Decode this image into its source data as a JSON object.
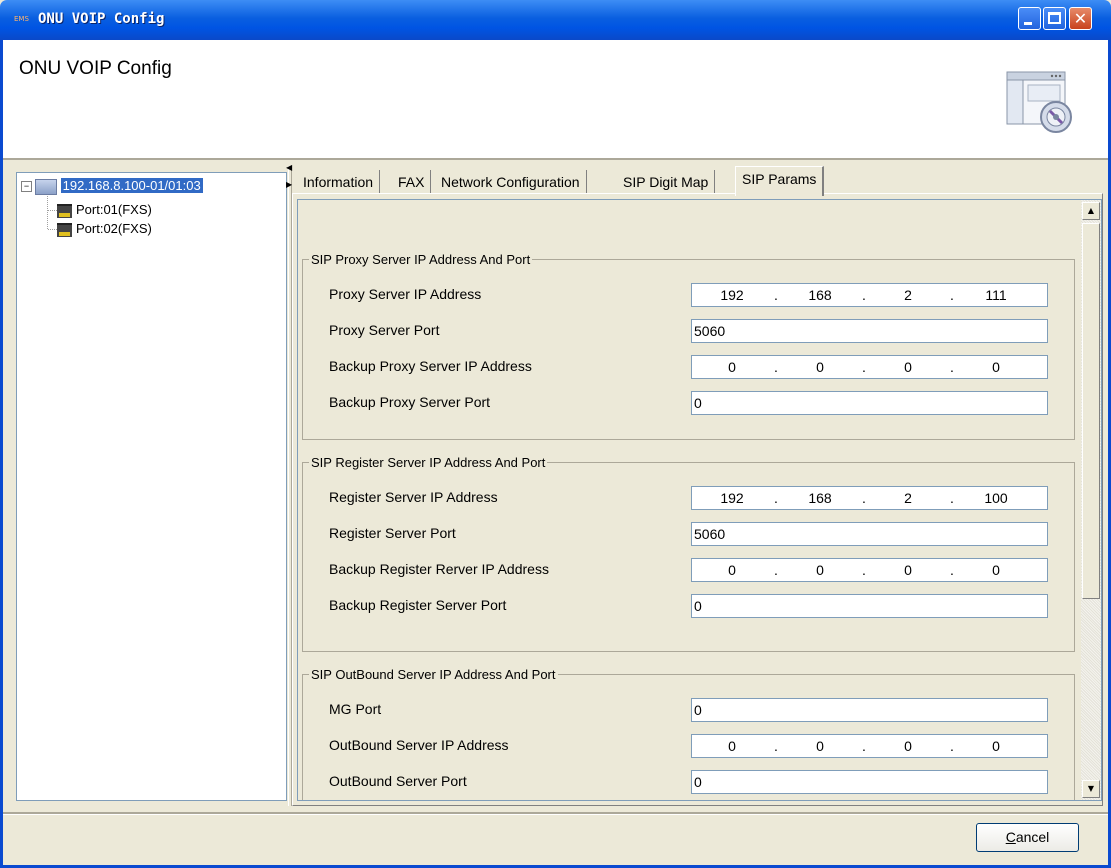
{
  "window": {
    "app_badge": "EMS",
    "title": "ONU VOIP Config"
  },
  "header": {
    "title": "ONU VOIP Config"
  },
  "tree": {
    "root": "192.168.8.100-01/01:03",
    "children": [
      "Port:01(FXS)",
      "Port:02(FXS)"
    ]
  },
  "tabs": [
    "Information",
    "FAX",
    "Network Configuration",
    "SIP Digit Map",
    "SIP Params"
  ],
  "active_tab": "SIP Params",
  "groups": [
    {
      "legend": "SIP Proxy Server IP Address And Port",
      "rows": [
        {
          "label": "Proxy Server IP Address",
          "ip": [
            "192",
            "168",
            "2",
            "111"
          ]
        },
        {
          "label": "Proxy Server Port",
          "value": "5060"
        },
        {
          "label": "Backup Proxy Server IP Address",
          "ip": [
            "0",
            "0",
            "0",
            "0"
          ]
        },
        {
          "label": "Backup Proxy Server Port",
          "value": "0"
        }
      ]
    },
    {
      "legend": "SIP Register Server IP Address And Port",
      "rows": [
        {
          "label": "Register Server IP Address",
          "ip": [
            "192",
            "168",
            "2",
            "100"
          ]
        },
        {
          "label": "Register Server Port",
          "value": "5060"
        },
        {
          "label": "Backup Register Rerver IP Address",
          "ip": [
            "0",
            "0",
            "0",
            "0"
          ]
        },
        {
          "label": "Backup Register Server Port",
          "value": "0"
        }
      ]
    },
    {
      "legend": "SIP OutBound Server IP Address And Port",
      "rows": [
        {
          "label": "MG Port",
          "value": "0"
        },
        {
          "label": "OutBound Server IP Address",
          "ip": [
            "0",
            "0",
            "0",
            "0"
          ]
        },
        {
          "label": "OutBound Server Port",
          "value": "0"
        }
      ]
    }
  ],
  "ip_separator": ".",
  "footer": {
    "cancel_label": "Cancel",
    "cancel_mnemonic": "C",
    "cancel_rest": "ancel"
  },
  "icons": {
    "header_image": "settings-window-icon",
    "tree_root": "computer-icon",
    "tree_child": "port-icon"
  },
  "colors": {
    "titlebar": "#0054e3",
    "selection": "#316ac5",
    "dialog_bg": "#ece9d8"
  }
}
